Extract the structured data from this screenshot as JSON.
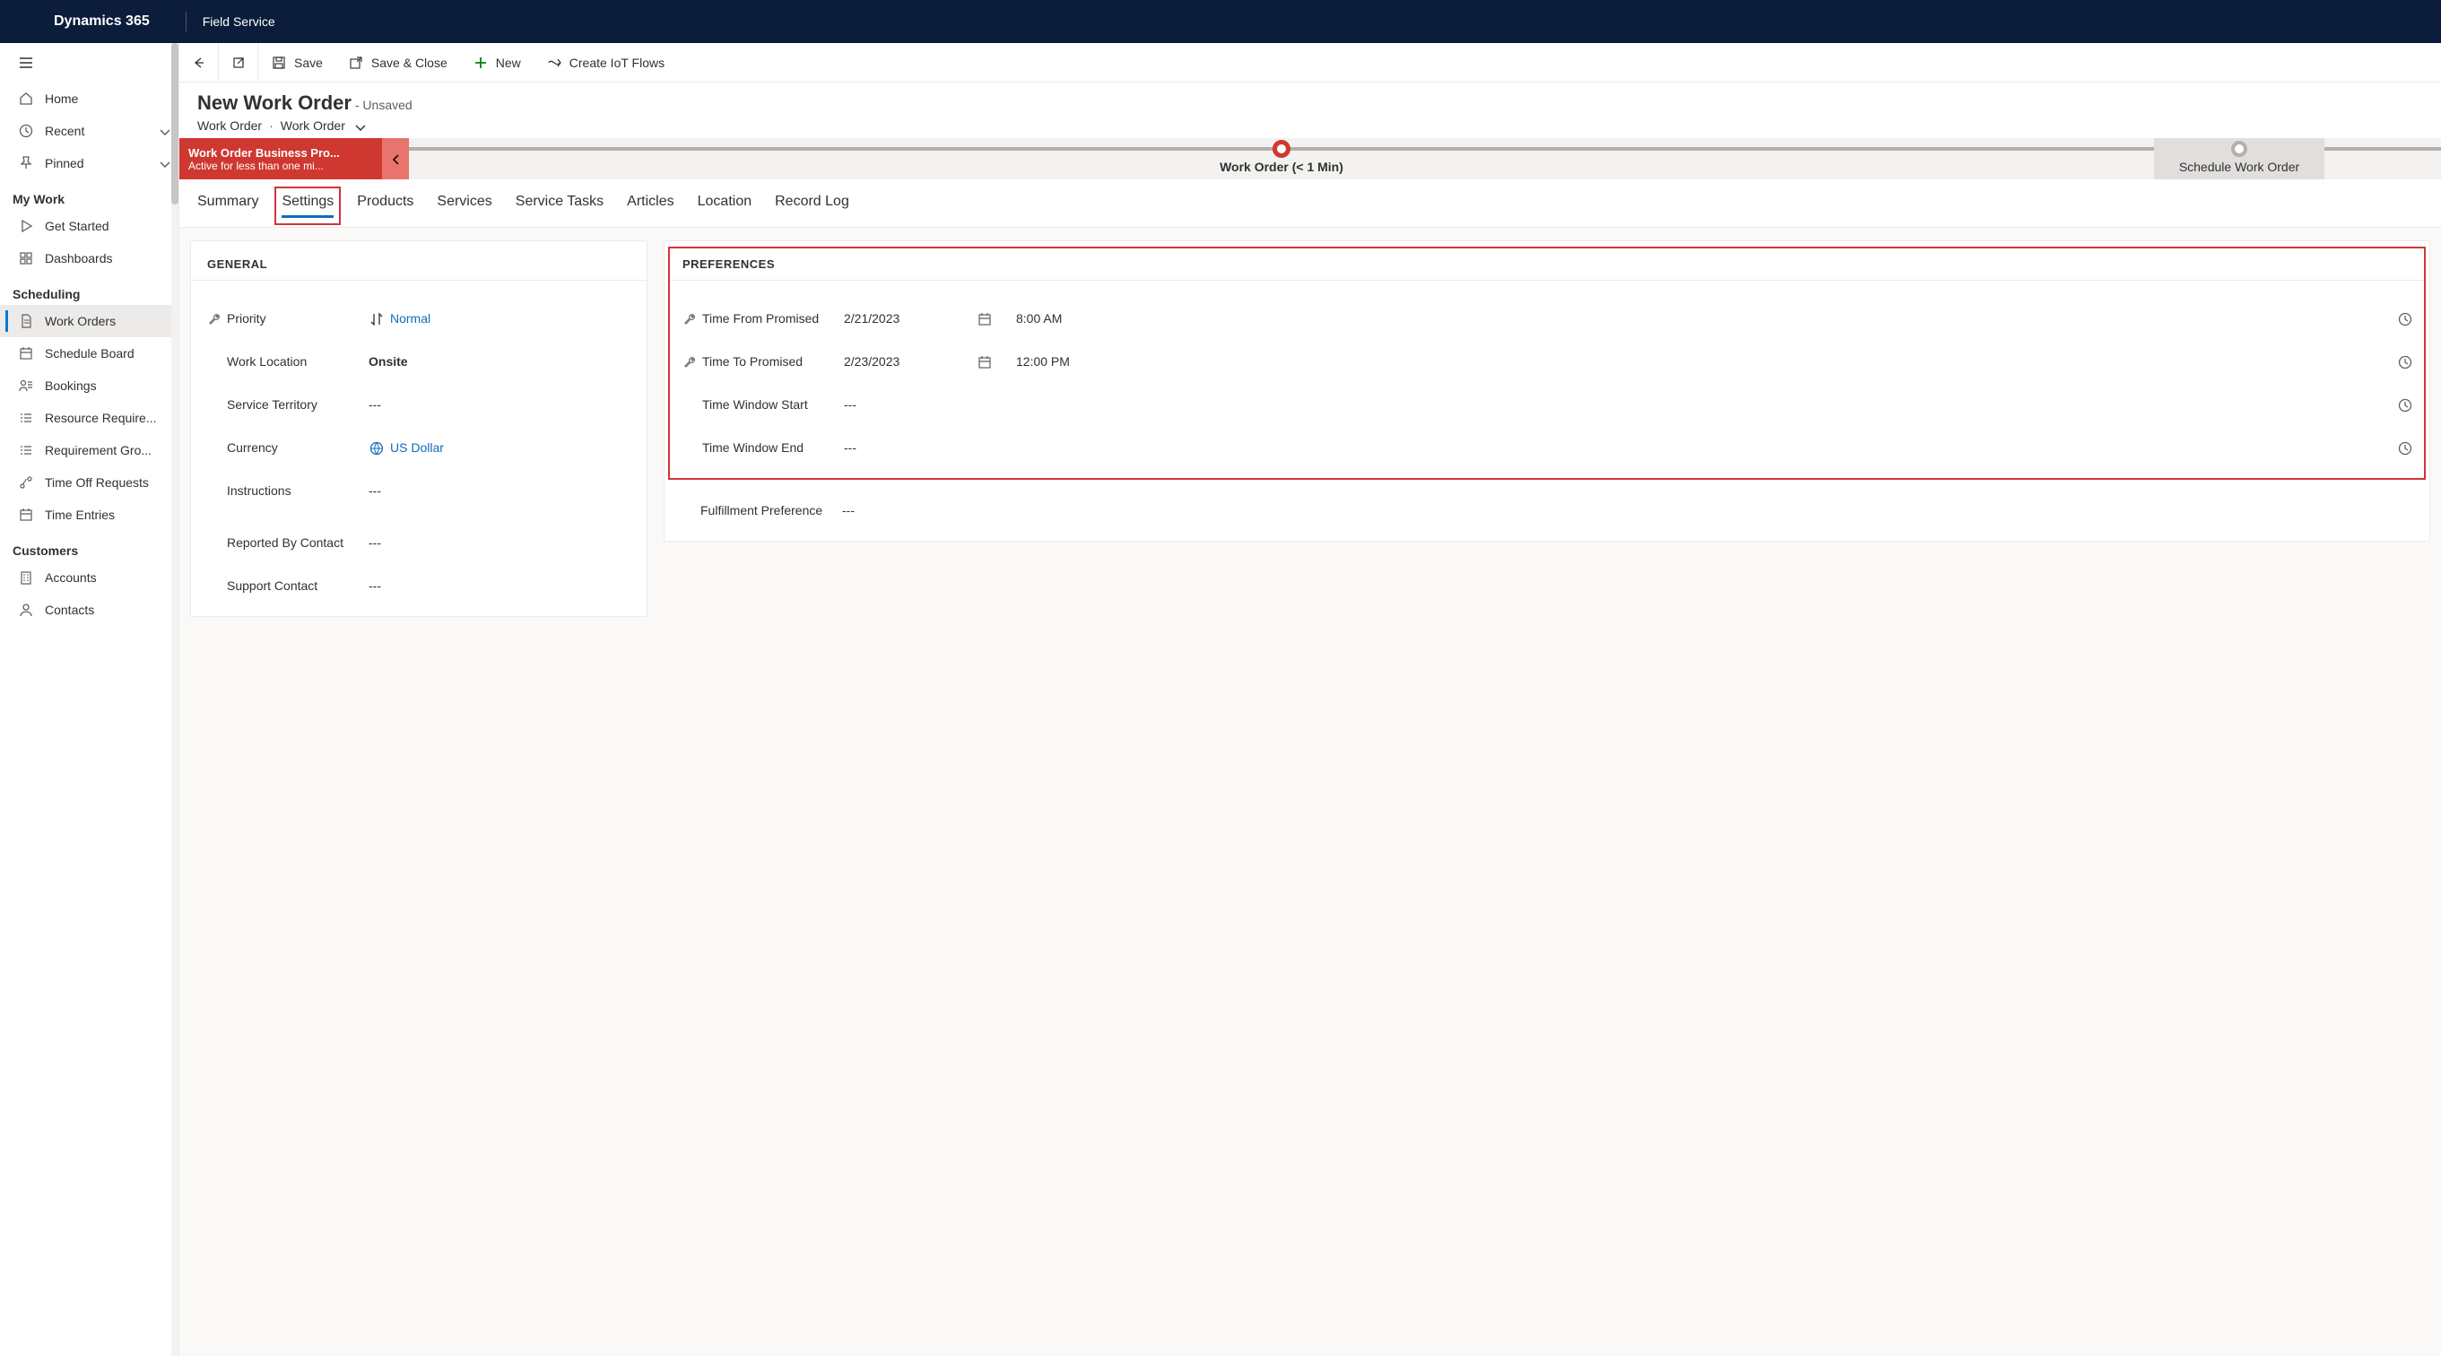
{
  "topbar": {
    "brand": "Dynamics 365",
    "subtitle": "Field Service"
  },
  "sidebar": {
    "home": "Home",
    "recent": "Recent",
    "pinned": "Pinned",
    "groups": {
      "mywork": "My Work",
      "scheduling": "Scheduling",
      "customers": "Customers"
    },
    "mywork": {
      "getstarted": "Get Started",
      "dashboards": "Dashboards"
    },
    "scheduling": {
      "workorders": "Work Orders",
      "scheduleboard": "Schedule Board",
      "bookings": "Bookings",
      "resourcereq": "Resource Require...",
      "reqgroups": "Requirement Gro...",
      "timeoff": "Time Off Requests",
      "timeentries": "Time Entries"
    },
    "customers": {
      "accounts": "Accounts",
      "contacts": "Contacts"
    }
  },
  "commands": {
    "save": "Save",
    "saveclose": "Save & Close",
    "new": "New",
    "iot": "Create IoT Flows"
  },
  "page": {
    "title": "New Work Order",
    "unsaved": "- Unsaved",
    "bc1": "Work Order",
    "bc2": "Work Order"
  },
  "bpf": {
    "title": "Work Order Business Pro...",
    "subtitle": "Active for less than one mi...",
    "stage1": "Work Order  (< 1 Min)",
    "stage2": "Schedule Work Order"
  },
  "tabs": {
    "summary": "Summary",
    "settings": "Settings",
    "products": "Products",
    "services": "Services",
    "servicetasks": "Service Tasks",
    "articles": "Articles",
    "location": "Location",
    "recordlog": "Record Log"
  },
  "general": {
    "heading": "GENERAL",
    "priority_l": "Priority",
    "priority_v": "Normal",
    "worklocation_l": "Work Location",
    "worklocation_v": "Onsite",
    "territory_l": "Service Territory",
    "territory_v": "---",
    "currency_l": "Currency",
    "currency_v": "US Dollar",
    "instructions_l": "Instructions",
    "instructions_v": "---",
    "reported_l": "Reported By Contact",
    "reported_v": "---",
    "support_l": "Support Contact",
    "support_v": "---"
  },
  "prefs": {
    "heading": "PREFERENCES",
    "tfp_l": "Time From Promised",
    "tfp_date": "2/21/2023",
    "tfp_time": "8:00 AM",
    "ttp_l": "Time To Promised",
    "ttp_date": "2/23/2023",
    "ttp_time": "12:00 PM",
    "tws_l": "Time Window Start",
    "tws_v": "---",
    "twe_l": "Time Window End",
    "twe_v": "---",
    "fulfill_l": "Fulfillment Preference",
    "fulfill_v": "---"
  }
}
